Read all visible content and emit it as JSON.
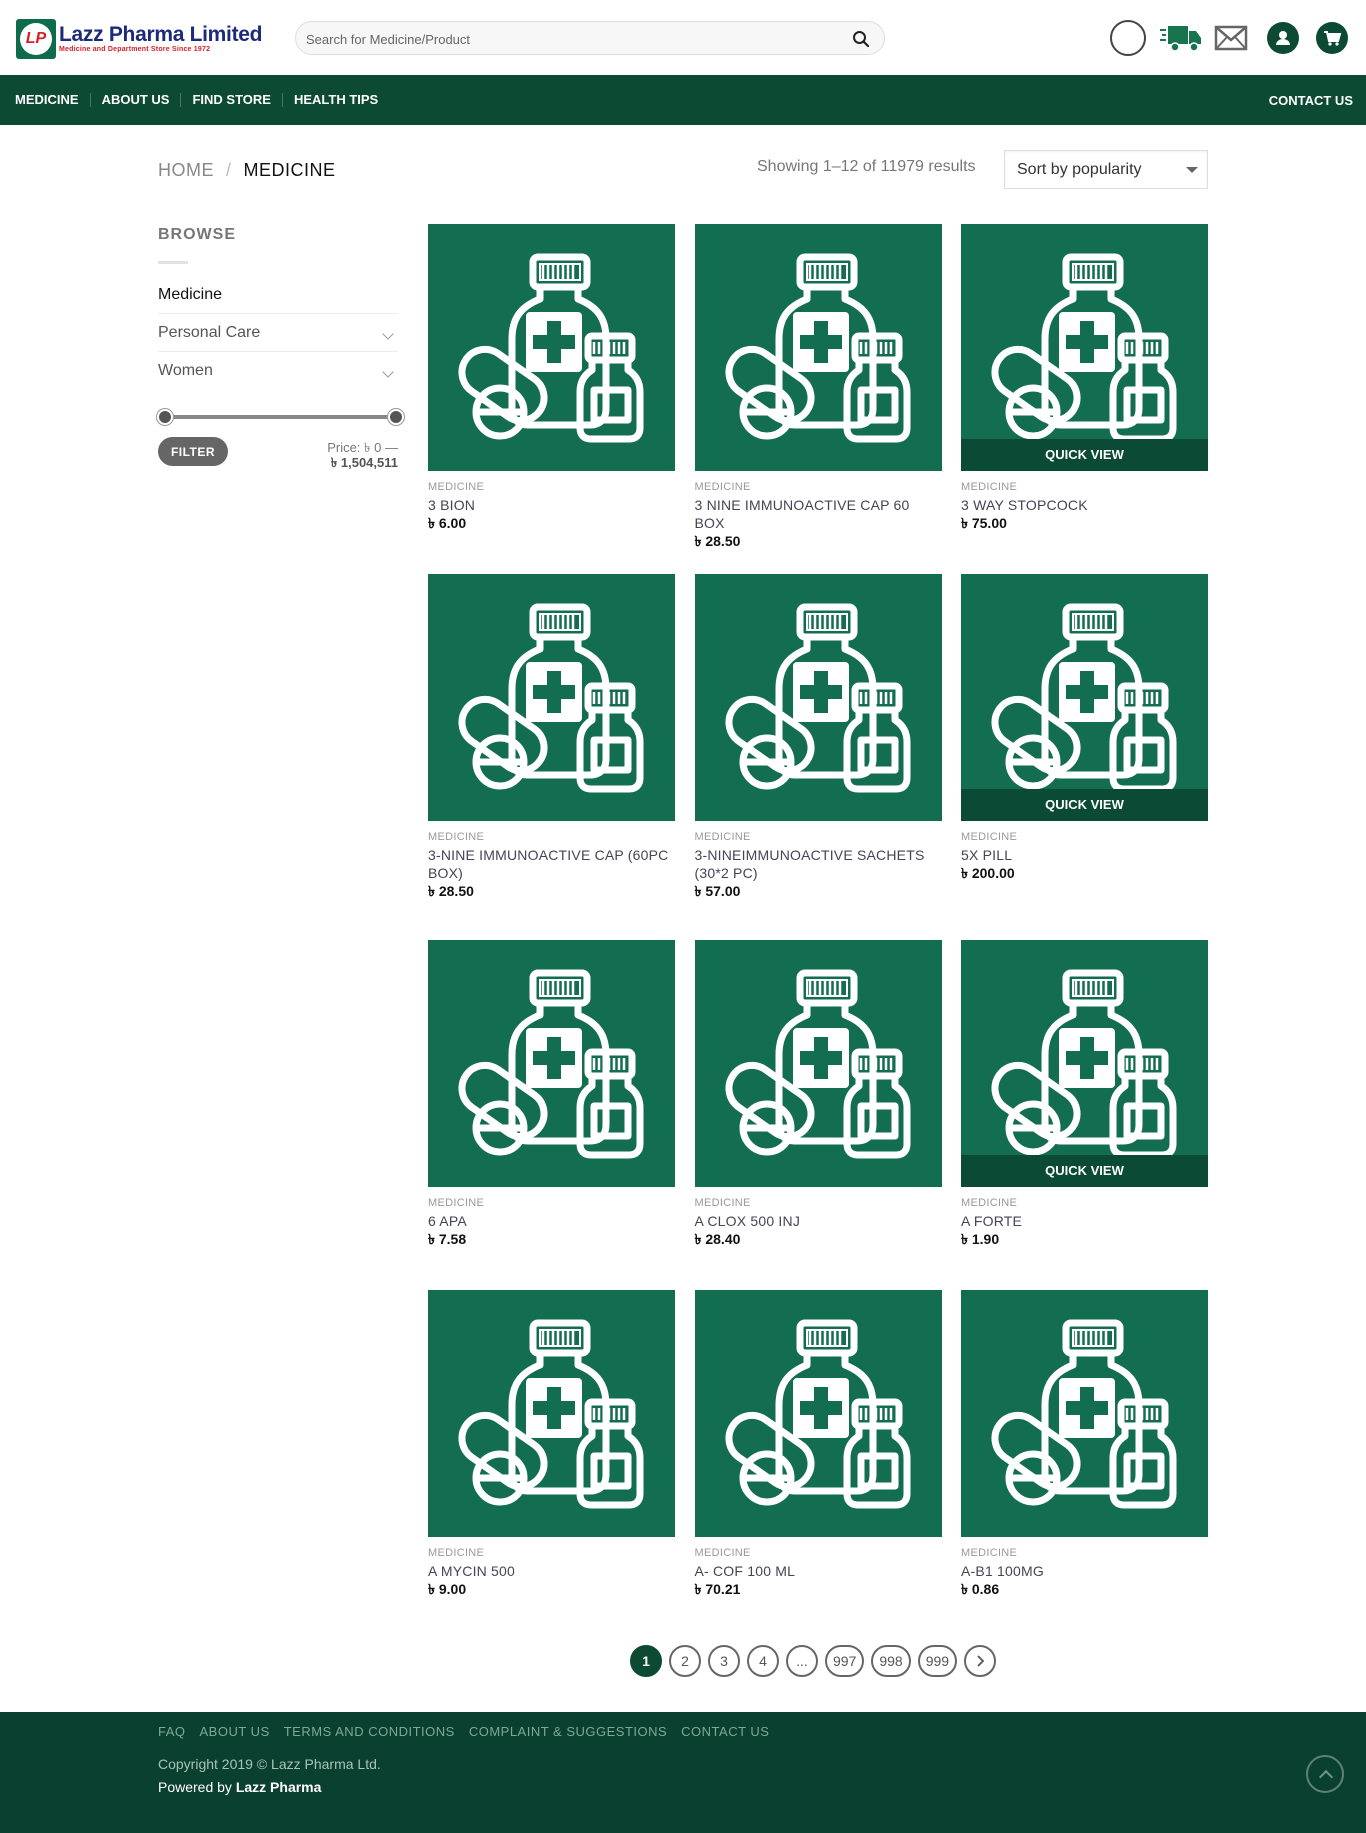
{
  "brand": {
    "name": "Lazz Pharma Limited",
    "tagline": "Medicine and Department Store Since 1972",
    "mark": "LP"
  },
  "search": {
    "placeholder": "Search for Medicine/Product"
  },
  "nav": {
    "items": [
      "MEDICINE",
      "ABOUT US",
      "FIND STORE",
      "HEALTH TIPS"
    ],
    "contact": "CONTACT US"
  },
  "breadcrumb": {
    "home": "HOME",
    "separator": "/",
    "current": "MEDICINE"
  },
  "results": {
    "text": "Showing 1–12 of 11979 results"
  },
  "sort": {
    "selected": "Sort by popularity"
  },
  "sidebar": {
    "title": "BROWSE",
    "categories": [
      {
        "label": "Medicine",
        "active": true
      },
      {
        "label": "Personal Care",
        "active": false
      },
      {
        "label": "Women",
        "active": false
      }
    ],
    "filter_label": "FILTER",
    "price_prefix": "Price:",
    "price_min": "৳ 0",
    "price_dash": "—",
    "price_max": "৳ 1,504,511"
  },
  "products": [
    {
      "category": "MEDICINE",
      "name": "3 BION",
      "price": "৳ 6.00",
      "quick_view": ""
    },
    {
      "category": "MEDICINE",
      "name": "3 NINE IMMUNOACTIVE CAP 60 BOX",
      "price": "৳ 28.50",
      "quick_view": ""
    },
    {
      "category": "MEDICINE",
      "name": "3 WAY STOPCOCK",
      "price": "৳ 75.00",
      "quick_view": "QUICK VIEW"
    },
    {
      "category": "MEDICINE",
      "name": "3-NINE IMMUNOACTIVE CAP (60PC BOX)",
      "price": "৳ 28.50",
      "quick_view": ""
    },
    {
      "category": "MEDICINE",
      "name": "3-NINEIMMUNOACTIVE SACHETS (30*2 PC)",
      "price": "৳ 57.00",
      "quick_view": ""
    },
    {
      "category": "MEDICINE",
      "name": "5X PILL",
      "price": "৳ 200.00",
      "quick_view": "QUICK VIEW"
    },
    {
      "category": "MEDICINE",
      "name": "6 APA",
      "price": "৳ 7.58",
      "quick_view": ""
    },
    {
      "category": "MEDICINE",
      "name": "A CLOX 500 INJ",
      "price": "৳ 28.40",
      "quick_view": ""
    },
    {
      "category": "MEDICINE",
      "name": "A FORTE",
      "price": "৳ 1.90",
      "quick_view": "QUICK VIEW"
    },
    {
      "category": "MEDICINE",
      "name": "A MYCIN 500",
      "price": "৳ 9.00",
      "quick_view": ""
    },
    {
      "category": "MEDICINE",
      "name": "A- COF 100 ML",
      "price": "৳ 70.21",
      "quick_view": ""
    },
    {
      "category": "MEDICINE",
      "name": "A-B1 100MG",
      "price": "৳ 0.86",
      "quick_view": ""
    }
  ],
  "pagination": {
    "pages": [
      "1",
      "2",
      "3",
      "4",
      "...",
      "997",
      "998",
      "999"
    ],
    "current": "1",
    "next_icon": "chevron-right-icon"
  },
  "footer": {
    "links": [
      "FAQ",
      "ABOUT US",
      "TERMS AND CONDITIONS",
      "COMPLAINT & SUGGESTIONS",
      "CONTACT US"
    ],
    "copyright": "Copyright 2019 © Lazz Pharma Ltd.",
    "powered_prefix": "Powered by ",
    "powered_name": "Lazz Pharma"
  },
  "colors": {
    "brand_green": "#0c4a34",
    "product_bg": "#136d51",
    "logo_red": "#d42027",
    "logo_navy": "#1b2a7a"
  },
  "icons": [
    "search-icon",
    "circle-icon",
    "delivery-truck-icon",
    "mail-icon",
    "user-icon",
    "cart-icon",
    "chevron-down-icon",
    "medicine-bottle-icon",
    "back-to-top-icon"
  ]
}
